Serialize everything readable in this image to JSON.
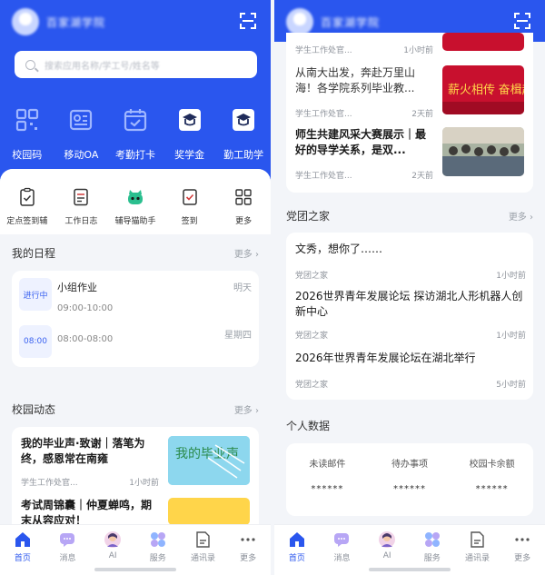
{
  "app": {
    "brand": "百家湖学院"
  },
  "search": {
    "placeholder": "搜索应用名称/学工号/姓名等"
  },
  "quick_links": [
    "校园码",
    "移动OA",
    "考勤打卡",
    "奖学金",
    "勤工助学"
  ],
  "tools": [
    "定点签到辅",
    "工作日志",
    "辅导猫助手",
    "签到",
    "更多"
  ],
  "schedule": {
    "title": "我的日程",
    "more": "更多",
    "items": [
      {
        "badge": "进行中",
        "title": "小组作业",
        "time": "09:00-10:00",
        "day": "明天"
      },
      {
        "badge": "08:00",
        "title": "",
        "time": "08:00-08:00",
        "day": "星期四"
      }
    ]
  },
  "campus_news": {
    "title": "校园动态",
    "more": "更多",
    "items": [
      {
        "title": "我的毕业声·致谢｜落笔为终，感恩常在南雍",
        "source": "学生工作处官...",
        "time": "1小时前"
      },
      {
        "title": "考试周锦囊｜仲夏蝉鸣，期末从容应对！",
        "source": "",
        "time": ""
      }
    ],
    "right_items": [
      {
        "title": "",
        "source": "学生工作处官...",
        "time": "1小时前"
      },
      {
        "title": "从南大出发，奔赴万里山海！各学院系列毕业教...",
        "source": "学生工作处官...",
        "time": "2天前"
      },
      {
        "title": "师生共建风采大赛展示｜最好的导学关系，是双...",
        "source": "学生工作处官...",
        "time": "2天前"
      }
    ],
    "thumb_texts": [
      "我的毕业声",
      "薪火相传 奋楫起"
    ]
  },
  "party": {
    "title": "党团之家",
    "more": "更多",
    "items": [
      {
        "title": "文秀，想你了……",
        "source": "党团之家",
        "time": "1小时前"
      },
      {
        "title": "2026世界青年发展论坛 探访湖北人形机器人创新中心",
        "source": "党团之家",
        "time": "1小时前"
      },
      {
        "title": "2026年世界青年发展论坛在湖北举行",
        "source": "党团之家",
        "time": "5小时前"
      }
    ]
  },
  "personal": {
    "title": "个人数据",
    "stats": [
      {
        "label": "未读邮件",
        "value": "******"
      },
      {
        "label": "待办事项",
        "value": "******"
      },
      {
        "label": "校园卡余额",
        "value": "******"
      }
    ]
  },
  "bottom_nav": [
    "首页",
    "消息",
    "AI",
    "服务",
    "通讯录",
    "更多"
  ],
  "colors": {
    "primary": "#2a56ee",
    "background": "#f3f5f9"
  }
}
